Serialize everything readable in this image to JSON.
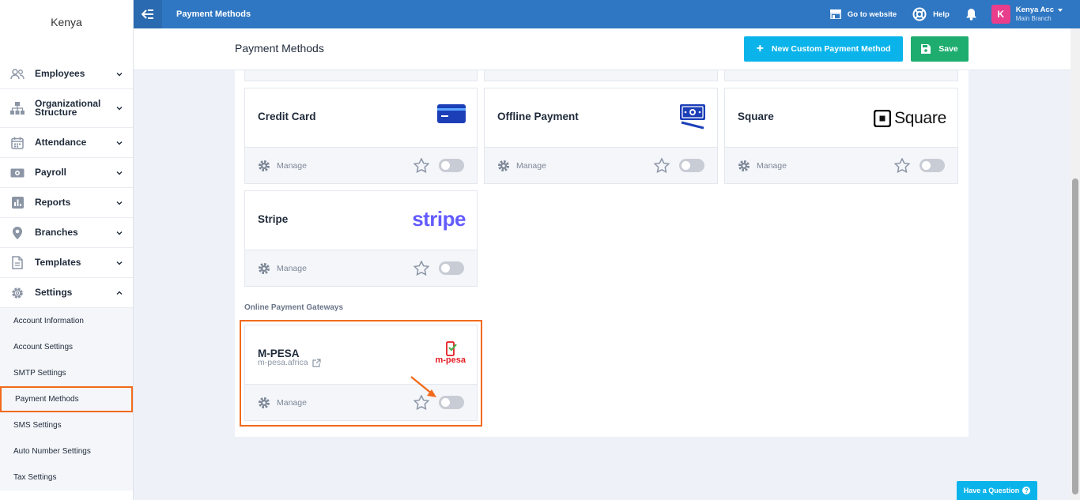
{
  "sidebar": {
    "brand": "Kenya",
    "items": [
      {
        "label": "Employees",
        "icon": "users-icon"
      },
      {
        "label": "Organizational Structure",
        "icon": "org-structure-icon"
      },
      {
        "label": "Attendance",
        "icon": "calendar-icon"
      },
      {
        "label": "Payroll",
        "icon": "money-icon"
      },
      {
        "label": "Reports",
        "icon": "chart-icon"
      },
      {
        "label": "Branches",
        "icon": "location-pin-icon"
      },
      {
        "label": "Templates",
        "icon": "document-icon"
      },
      {
        "label": "Settings",
        "icon": "gear-icon"
      }
    ],
    "settings_submenu": [
      "Account Information",
      "Account Settings",
      "SMTP Settings",
      "Payment Methods",
      "SMS Settings",
      "Auto Number Settings",
      "Tax Settings"
    ]
  },
  "topbar": {
    "title": "Payment Methods",
    "go_to_website": "Go to website",
    "help": "Help",
    "user_initial": "K",
    "user_name": "Kenya Acc",
    "user_branch": "Main Branch"
  },
  "header": {
    "title": "Payment Methods",
    "new_button": "New Custom Payment Method",
    "save_button": "Save"
  },
  "cards": [
    {
      "name": "Credit Card",
      "logo": "credit-card-icon"
    },
    {
      "name": "Offline Payment",
      "logo": "cash-icon"
    },
    {
      "name": "Square",
      "logo_text": "Square"
    },
    {
      "name": "Stripe",
      "logo_text": "stripe"
    }
  ],
  "manage_label": "Manage",
  "section_label": "Online Payment Gateways",
  "gateways": [
    {
      "name": "M-PESA",
      "url": "m-pesa.africa",
      "logo_text": "m-pesa"
    }
  ],
  "help_button": "Have a Question",
  "colors": {
    "topbar": "#2f77c2",
    "new_button": "#0ab4ea",
    "save_button": "#1ead6f",
    "highlight": "#f26a1b"
  }
}
